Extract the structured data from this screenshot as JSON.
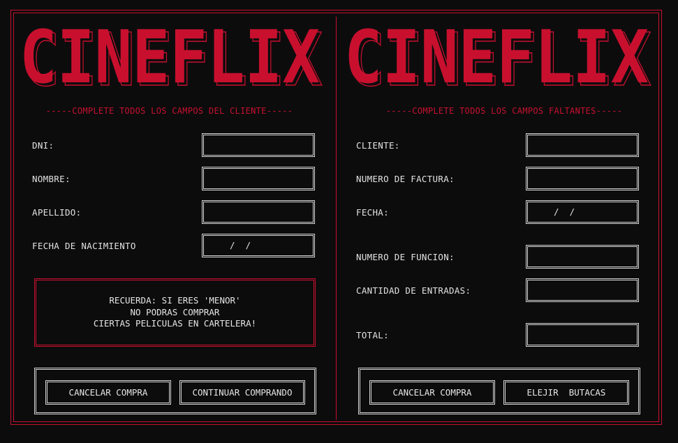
{
  "brand": {
    "logo_text": "CINEFLIX",
    "accent_color": "#c8102e"
  },
  "left_panel": {
    "subtitle": "-----COMPLETE TODOS LOS CAMPOS DEL CLIENTE-----",
    "fields": [
      {
        "label": "DNI:",
        "value": ""
      },
      {
        "label": "NOMBRE:",
        "value": ""
      },
      {
        "label": "APELLIDO:",
        "value": ""
      },
      {
        "label": "FECHA DE NACIMIENTO",
        "value": "  /  /"
      }
    ],
    "notice_lines": [
      "RECUERDA: SI ERES 'MENOR'",
      "NO PODRAS COMPRAR",
      "CIERTAS PELICULAS EN CARTELERA!"
    ],
    "buttons": {
      "cancel": "CANCELAR COMPRA",
      "continue": "CONTINUAR COMPRANDO"
    }
  },
  "right_panel": {
    "subtitle": "-----COMPLETE TODOS LOS CAMPOS FALTANTES-----",
    "fields": [
      {
        "label": "CLIENTE:",
        "value": ""
      },
      {
        "label": "NUMERO DE FACTURA:",
        "value": ""
      },
      {
        "label": "FECHA:",
        "value": "  /  /"
      },
      {
        "label": "NUMERO DE FUNCION:",
        "value": ""
      },
      {
        "label": "CANTIDAD DE ENTRADAS:",
        "value": ""
      },
      {
        "label": "TOTAL:",
        "value": ""
      }
    ],
    "buttons": {
      "cancel": "CANCELAR COMPRA",
      "seats": "ELEJIR  BUTACAS"
    }
  }
}
